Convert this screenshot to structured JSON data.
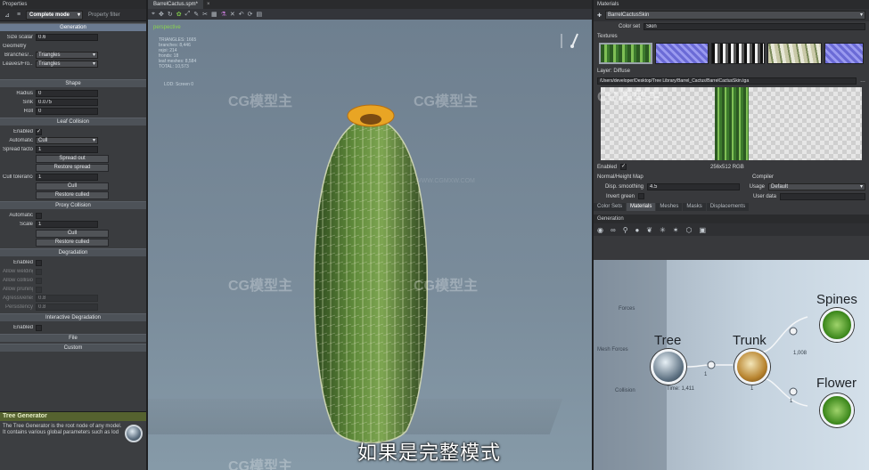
{
  "left": {
    "title": "Properties",
    "toolbar": {
      "mode": "Complete mode",
      "filter_tab": "Property filter"
    },
    "sections": {
      "generation": "Generation",
      "shape": "Shape",
      "leaf_collision": "Leaf Collision",
      "proxy_collision": "Proxy Collision",
      "degradation": "Degradation",
      "interactive_degradation": "Interactive Degradation",
      "file": "File",
      "custom": "Custom"
    },
    "size_scalar": {
      "label": "Size scalar",
      "value": "0.6"
    },
    "geometry_label": "Geometry",
    "branches": {
      "label": "Branches/...",
      "value": "Triangles"
    },
    "leaves": {
      "label": "Leaves/Fro...",
      "value": "Triangles"
    },
    "radius": {
      "label": "Radius",
      "value": "0"
    },
    "sink": {
      "label": "Sink",
      "value": "0.075"
    },
    "roll": {
      "label": "Roll",
      "value": "0"
    },
    "lc_enabled": {
      "label": "Enabled",
      "value": "✓"
    },
    "lc_automatic": {
      "label": "Automatic",
      "value": "Cull"
    },
    "spread_factor": {
      "label": "Spread factor",
      "value": "1"
    },
    "spread_out": "Spread out",
    "restore_spread": "Restore spread",
    "cull_tolerance": {
      "label": "Cull tolerance",
      "value": "1"
    },
    "cull": "Cull",
    "restore_culled": "Restore culled",
    "pc_automatic": {
      "label": "Automatic"
    },
    "pc_scale": {
      "label": "Scale",
      "value": "1"
    },
    "pc_cull": "Cull",
    "pc_restore": "Restore culled",
    "dg_enabled": {
      "label": "Enabled"
    },
    "dg_rows": [
      "Allow welding",
      "Allow collision",
      "Allow pruning",
      "Agressiveness",
      "Persistency"
    ],
    "dg_values": [
      "",
      "",
      "",
      "0.8",
      "0.8"
    ],
    "id_enabled": {
      "label": "Enabled"
    },
    "help_title": "Tree Generator",
    "help_text": "The Tree Generator is the root node of any model. It contains various global parameters such as lod"
  },
  "center": {
    "tab": "BarrelCactus.spm*",
    "view": "perspective",
    "stats": [
      "TRIANGLES: 1665",
      "branches: 8,446",
      "rejoi: 214",
      "fronds: 18",
      "leaf meshes: 8,584",
      "TOTAL: 10,573"
    ],
    "lod": "LOD: Screen 0",
    "watermarks": [
      "CG模型主",
      "CG模型主",
      "CG模型主",
      "CG模型主",
      "CG模型主",
      "CG模型主"
    ],
    "watermark_url": "WWW.CGMXW.COM",
    "subtitle": "如果是完整模式"
  },
  "right": {
    "title": "Materials",
    "material_name": "BarrelCactusSkin",
    "color_set_label": "Color set",
    "color_set_value": "Skin",
    "textures_label": "Textures",
    "layer_label": "Layer: Diffuse",
    "path": "/Users/developer/Desktop/Tree Library/Barrel_Cactus/BarrelCactusSkin.tga",
    "enabled_label": "Enabled",
    "enabled_value": "✓",
    "size_info": "256x512 RGB",
    "normal_height": "Normal/Height Map",
    "disp_smoothing_label": "Disp. smoothing",
    "disp_smoothing_value": "4.5",
    "invert_green": "Invert green",
    "compiler_label": "Compiler",
    "usage_label": "Usage",
    "usage_value": "Default",
    "user_data_label": "User data",
    "tabs": [
      "Color Sets",
      "Materials",
      "Meshes",
      "Masks",
      "Displacements"
    ],
    "generation_title": "Generation",
    "nodes": {
      "tree": "Tree",
      "trunk": "Trunk",
      "spines": "Spines",
      "flower": "Flower"
    },
    "side_labels": {
      "forces": "Forces",
      "mesh_forces": "Mesh Forces",
      "collision": "Collision"
    },
    "counts": {
      "tree_trunk": "1",
      "trunk_spines": "1,008",
      "trunk_flower": "1",
      "tree_under": "1",
      "trunk_under": "1",
      "tree_time": "Time: 1,411"
    }
  }
}
